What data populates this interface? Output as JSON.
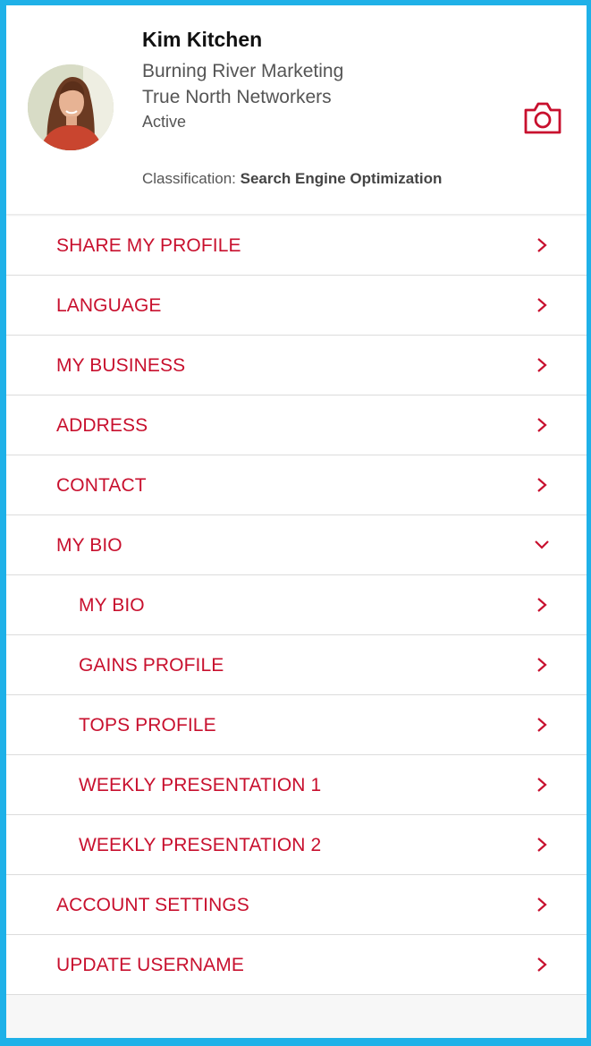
{
  "profile": {
    "name": "Kim Kitchen",
    "company": "Burning River Marketing",
    "chapter": "True North Networkers",
    "status": "Active",
    "classification_label": "Classification:",
    "classification_value": "Search Engine Optimization"
  },
  "colors": {
    "accent": "#c8102e",
    "frame": "#1fb1e8"
  },
  "icons": {
    "camera": "camera-icon",
    "chevron_right": "chevron-right-icon",
    "chevron_down": "chevron-down-icon"
  },
  "menu": {
    "share_my_profile": "SHARE MY PROFILE",
    "language": "LANGUAGE",
    "my_business": "MY BUSINESS",
    "address": "ADDRESS",
    "contact": "CONTACT",
    "my_bio": "MY BIO",
    "account_settings": "ACCOUNT SETTINGS",
    "update_username": "UPDATE USERNAME"
  },
  "my_bio_submenu": {
    "my_bio": "MY BIO",
    "gains_profile": "GAINS PROFILE",
    "tops_profile": "TOPS PROFILE",
    "weekly_presentation_1": "WEEKLY PRESENTATION 1",
    "weekly_presentation_2": "WEEKLY PRESENTATION 2"
  }
}
